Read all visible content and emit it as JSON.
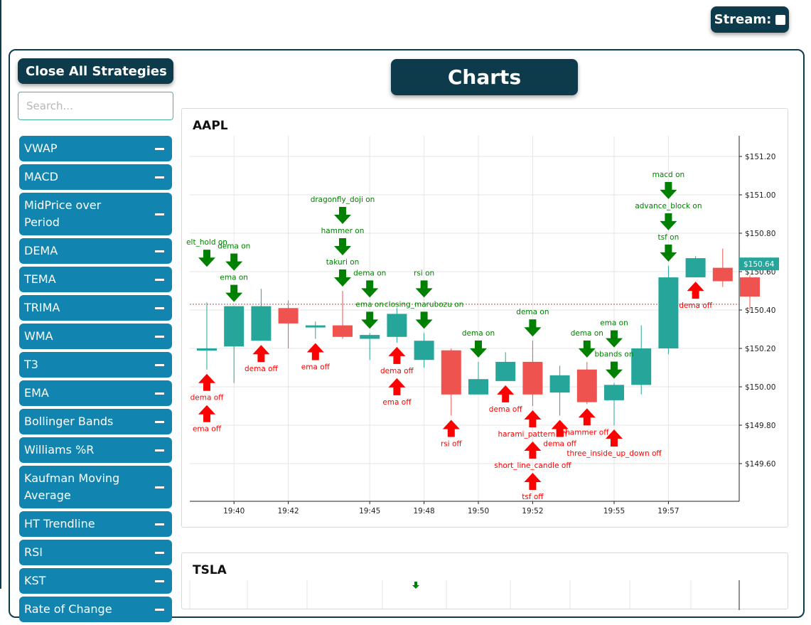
{
  "header": {
    "stream_label": "Stream:"
  },
  "sidebar": {
    "close_all_label": "Close All Strategies",
    "search_placeholder": "Search...",
    "strategies": [
      {
        "label": "VWAP"
      },
      {
        "label": "MACD"
      },
      {
        "label": "MidPrice over Period"
      },
      {
        "label": "DEMA"
      },
      {
        "label": "TEMA"
      },
      {
        "label": "TRIMA"
      },
      {
        "label": "WMA"
      },
      {
        "label": "T3"
      },
      {
        "label": "EMA"
      },
      {
        "label": "Bollinger Bands"
      },
      {
        "label": "Williams %R"
      },
      {
        "label": "Kaufman Moving Average"
      },
      {
        "label": "HT Trendline"
      },
      {
        "label": "RSI"
      },
      {
        "label": "KST"
      },
      {
        "label": "Rate of Change"
      }
    ]
  },
  "main": {
    "title": "Charts"
  },
  "colors": {
    "up": "#26a69a",
    "down": "#ef5350",
    "signal_on": "#008000",
    "signal_off": "#ff0000",
    "dark": "#0d3b4c",
    "button": "#1185b0"
  },
  "chart_data": [
    {
      "type": "candlestick",
      "title": "AAPL",
      "ylim": [
        149.45,
        151.28
      ],
      "y_ticks": [
        149.6,
        149.8,
        150.0,
        150.2,
        150.4,
        150.6,
        150.8,
        151.0,
        151.2
      ],
      "y_tick_labels": [
        "$149.60",
        "$149.80",
        "$150.00",
        "$150.20",
        "$150.40",
        "$150.60",
        "$150.80",
        "$151.00",
        "$151.20"
      ],
      "x_tick_labels": [
        "19:40",
        "19:42",
        "19:45",
        "19:48",
        "19:50",
        "19:52",
        "19:55",
        "19:57"
      ],
      "x_tick_candle_index": [
        1,
        3,
        6,
        8,
        10,
        12,
        15,
        17
      ],
      "last_price_label": "$150.64",
      "last_price": 150.64,
      "reference_price": 150.43,
      "candles": [
        {
          "o": 150.2,
          "h": 150.44,
          "l": 150.09,
          "c": 150.2
        },
        {
          "o": 150.21,
          "h": 150.42,
          "l": 150.02,
          "c": 150.42
        },
        {
          "o": 150.24,
          "h": 150.51,
          "l": 150.24,
          "c": 150.42
        },
        {
          "o": 150.41,
          "h": 150.45,
          "l": 150.2,
          "c": 150.33
        },
        {
          "o": 150.32,
          "h": 150.34,
          "l": 150.25,
          "c": 150.32
        },
        {
          "o": 150.32,
          "h": 150.5,
          "l": 150.25,
          "c": 150.26
        },
        {
          "o": 150.25,
          "h": 150.28,
          "l": 150.14,
          "c": 150.27
        },
        {
          "o": 150.26,
          "h": 150.41,
          "l": 150.23,
          "c": 150.38
        },
        {
          "o": 150.14,
          "h": 150.28,
          "l": 150.1,
          "c": 150.24
        },
        {
          "o": 150.19,
          "h": 150.2,
          "l": 149.85,
          "c": 149.96
        },
        {
          "o": 149.96,
          "h": 150.13,
          "l": 149.96,
          "c": 150.04
        },
        {
          "o": 150.03,
          "h": 150.18,
          "l": 150.03,
          "c": 150.13
        },
        {
          "o": 150.13,
          "h": 150.24,
          "l": 149.9,
          "c": 149.96
        },
        {
          "o": 149.97,
          "h": 150.11,
          "l": 149.85,
          "c": 150.06
        },
        {
          "o": 150.09,
          "h": 150.13,
          "l": 149.91,
          "c": 149.92
        },
        {
          "o": 149.93,
          "h": 150.02,
          "l": 149.8,
          "c": 150.01
        },
        {
          "o": 150.01,
          "h": 150.32,
          "l": 149.96,
          "c": 150.2
        },
        {
          "o": 150.2,
          "h": 150.63,
          "l": 150.17,
          "c": 150.57
        },
        {
          "o": 150.57,
          "h": 150.68,
          "l": 150.57,
          "c": 150.67
        },
        {
          "o": 150.62,
          "h": 150.72,
          "l": 150.52,
          "c": 150.55
        },
        {
          "o": 150.57,
          "h": 150.58,
          "l": 150.4,
          "c": 150.47
        }
      ],
      "signals": [
        {
          "text": "ema on",
          "type": "on",
          "candle": 1,
          "tier": 0
        },
        {
          "text": "dema on",
          "type": "on",
          "candle": 1,
          "tier": 1
        },
        {
          "text": "elt_hold on",
          "type": "on",
          "candle": 0,
          "tier": 1
        },
        {
          "text": "dema off",
          "type": "off",
          "candle": 0,
          "tier": 0
        },
        {
          "text": "ema off",
          "type": "off",
          "candle": 0,
          "tier": 1
        },
        {
          "text": "dema off",
          "type": "off",
          "candle": 2,
          "tier": 0
        },
        {
          "text": "ema off",
          "type": "off",
          "candle": 4,
          "tier": 0
        },
        {
          "text": "takuri on",
          "type": "on",
          "candle": 5,
          "tier": 0
        },
        {
          "text": "hammer on",
          "type": "on",
          "candle": 5,
          "tier": 1
        },
        {
          "text": "dragonfly_doji on",
          "type": "on",
          "candle": 5,
          "tier": 2
        },
        {
          "text": "ema on",
          "type": "on",
          "candle": 6,
          "tier": 0
        },
        {
          "text": "dema on",
          "type": "on",
          "candle": 6,
          "tier": 1
        },
        {
          "text": "closing_marubozu on",
          "type": "on",
          "candle": 8,
          "tier": 0
        },
        {
          "text": "rsi on",
          "type": "on",
          "candle": 8,
          "tier": 1
        },
        {
          "text": "dema off",
          "type": "off",
          "candle": 7,
          "tier": 0
        },
        {
          "text": "ema off",
          "type": "off",
          "candle": 7,
          "tier": 1
        },
        {
          "text": "rsi off",
          "type": "off",
          "candle": 9,
          "tier": 0
        },
        {
          "text": "dema on",
          "type": "on",
          "candle": 10,
          "tier": 0
        },
        {
          "text": "dema on",
          "type": "on",
          "candle": 12,
          "tier": 0
        },
        {
          "text": "dema off",
          "type": "off",
          "candle": 11,
          "tier": 0
        },
        {
          "text": "harami_pattern off",
          "type": "off",
          "candle": 12,
          "tier": 0
        },
        {
          "text": "short_line_candle off",
          "type": "off",
          "candle": 12,
          "tier": 1
        },
        {
          "text": "tsf off",
          "type": "off",
          "candle": 12,
          "tier": 2
        },
        {
          "text": "dema off",
          "type": "off",
          "candle": 13,
          "tier": 0
        },
        {
          "text": "dema on",
          "type": "on",
          "candle": 14,
          "tier": 0
        },
        {
          "text": "hammer off",
          "type": "off",
          "candle": 14,
          "tier": 0
        },
        {
          "text": "bbands on",
          "type": "on",
          "candle": 15,
          "tier": 0
        },
        {
          "text": "ema on",
          "type": "on",
          "candle": 15,
          "tier": 1
        },
        {
          "text": "three_inside_up_down off",
          "type": "off",
          "candle": 15,
          "tier": 0
        },
        {
          "text": "tsf on",
          "type": "on",
          "candle": 17,
          "tier": 0
        },
        {
          "text": "advance_block on",
          "type": "on",
          "candle": 17,
          "tier": 1
        },
        {
          "text": "macd on",
          "type": "on",
          "candle": 17,
          "tier": 2
        },
        {
          "text": "dema off",
          "type": "off",
          "candle": 18,
          "tier": 0
        }
      ]
    },
    {
      "type": "candlestick",
      "title": "TSLA"
    }
  ]
}
